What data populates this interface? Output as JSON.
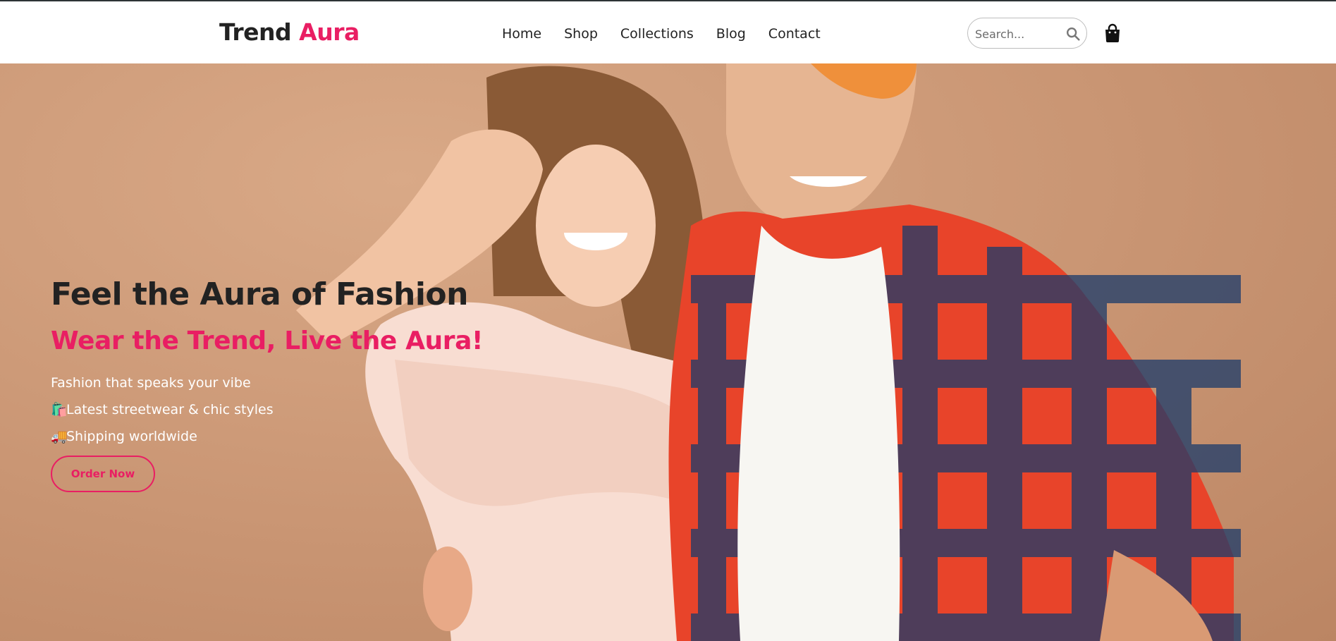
{
  "header": {
    "logo_part1": "Trend",
    "logo_part2": "Aura",
    "nav": [
      "Home",
      "Shop",
      "Collections",
      "Blog",
      "Contact"
    ],
    "search_placeholder": "Search...",
    "search_icon": "search-icon",
    "cart_icon": "shopping-bag-icon"
  },
  "hero": {
    "headline": "Feel the Aura of Fashion",
    "subheadline": "Wear the Trend, Live the Aura!",
    "lines": [
      {
        "emoji": "",
        "text": "Fashion that speaks your vibe"
      },
      {
        "emoji": "🛍️",
        "text": "Latest streetwear & chic styles"
      },
      {
        "emoji": "🚚",
        "text": "Shipping worldwide"
      }
    ],
    "cta_label": "Order Now"
  },
  "colors": {
    "accent": "#e91e63",
    "text_dark": "#222222",
    "hero_bg": "#c99573"
  }
}
